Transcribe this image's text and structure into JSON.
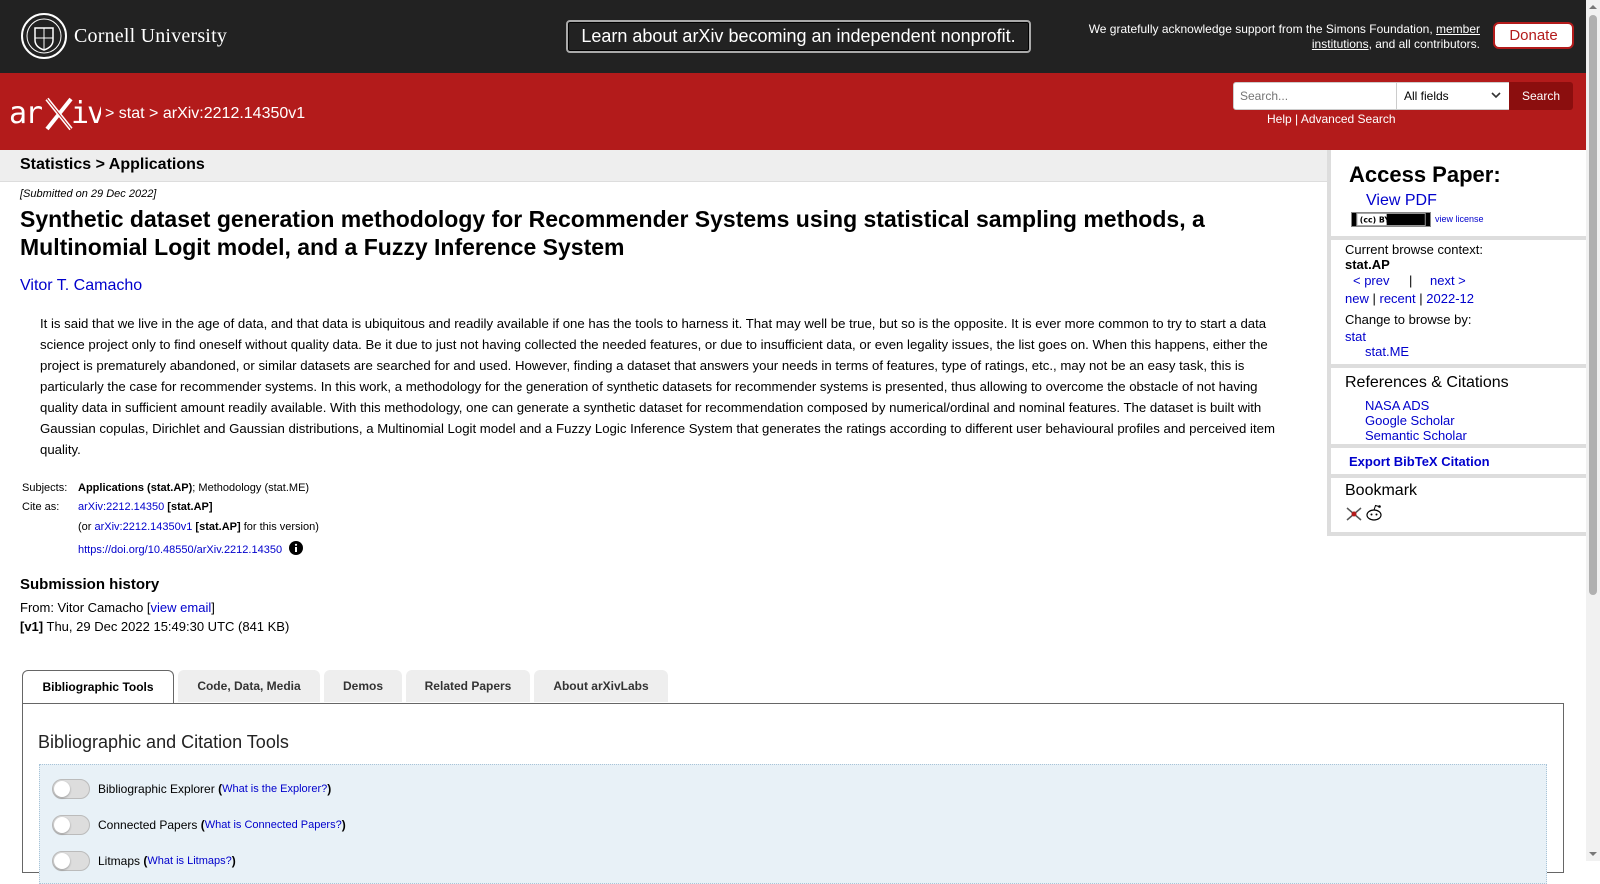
{
  "topbar": {
    "institution": "Cornell University",
    "nonprofit_banner": "Learn about arXiv becoming an independent nonprofit.",
    "ack_prefix": "We gratefully acknowledge support from the Simons Foundation, ",
    "ack_link1": "member",
    "ack_link2": "institutions",
    "ack_suffix": ", and all contributors.",
    "donate_label": "Donate"
  },
  "header": {
    "crumb_sep1": ">",
    "crumb_stat": "stat",
    "crumb_sep2": ">",
    "crumb_id": "arXiv:2212.14350v1",
    "search_placeholder": "Search...",
    "search_field": "All fields",
    "search_button": "Search",
    "help": "Help",
    "help_sep": "|",
    "advanced": "Advanced Search"
  },
  "subheader": "Statistics > Applications",
  "paper": {
    "submitted": "[Submitted on 29 Dec 2022]",
    "title": "Synthetic dataset generation methodology for Recommender Systems using statistical sampling methods, a Multinomial Logit model, and a Fuzzy Inference System",
    "author": "Vitor T. Camacho",
    "abstract": "It is said that we live in the age of data, and that data is ubiquitous and readily available if one has the tools to harness it. That may well be true, but so is the opposite. It is ever more common to try to start a data science project only to find oneself without quality data. Be it due to just not having collected the needed features, or due to insufficient data, or even legality issues, the list goes on. When this happens, either the project is prematurely abandoned, or similar datasets are searched for and used. However, finding a dataset that answers your needs in terms of features, type of ratings, etc., may not be an easy task, this is particularly the case for recommender systems. In this work, a methodology for the generation of synthetic datasets for recommender systems is presented, thus allowing to overcome the obstacle of not having quality data in sufficient amount readily available. With this methodology, one can generate a synthetic dataset for recommendation composed by numerical/ordinal and nominal features. The dataset is built with Gaussian copulas, Dirichlet and Gaussian distributions, a Multinomial Logit model and a Fuzzy Logic Inference System that generates the ratings according to different user behavioural profiles and perceived item quality."
  },
  "meta": {
    "subjects_label": "Subjects:",
    "subjects_primary": "Applications (stat.AP)",
    "subjects_rest": "; Methodology (stat.ME)",
    "cite_label": "Cite as:",
    "cite_id": "arXiv:2212.14350",
    "cite_cat": "[stat.AP]",
    "or_prefix": "(or ",
    "version_id": "arXiv:2212.14350v1",
    "version_cat": "[stat.AP]",
    "version_suffix": " for this version)",
    "doi": "https://doi.org/10.48550/arXiv.2212.14350"
  },
  "history": {
    "title": "Submission history",
    "from_prefix": "From: Vitor Camacho [",
    "view_email": "view email",
    "from_suffix": "]",
    "v1_label": "[v1]",
    "v1_text": " Thu, 29 Dec 2022 15:49:30 UTC (841 KB)"
  },
  "tabs": [
    {
      "label": "Bibliographic Tools"
    },
    {
      "label": "Code, Data, Media"
    },
    {
      "label": "Demos"
    },
    {
      "label": "Related Papers"
    },
    {
      "label": "About arXivLabs"
    }
  ],
  "panel": {
    "title": "Bibliographic and Citation Tools",
    "tools": [
      {
        "name": "Bibliographic Explorer",
        "link": "What is the Explorer?"
      },
      {
        "name": "Connected Papers",
        "link": "What is Connected Papers?"
      },
      {
        "name": "Litmaps",
        "link": "What is Litmaps?"
      }
    ]
  },
  "sidebar": {
    "access_title": "Access Paper:",
    "view_pdf": "View PDF",
    "cc_label": "(cc) BY",
    "view_license": "view license",
    "context_label": "Current browse context:",
    "context_value": "stat.AP",
    "prev": "< prev",
    "nav_sep": "|",
    "next": "next >",
    "new": "new",
    "recent": "recent",
    "month": "2022-12",
    "change_label": "Change to browse by:",
    "browse_stat": "stat",
    "browse_me": "stat.ME",
    "refs_title": "References & Citations",
    "nasa": "NASA ADS",
    "scholar": "Google Scholar",
    "semantic": "Semantic Scholar",
    "bibtex": "Export BibTeX Citation",
    "bookmark": "Bookmark"
  }
}
